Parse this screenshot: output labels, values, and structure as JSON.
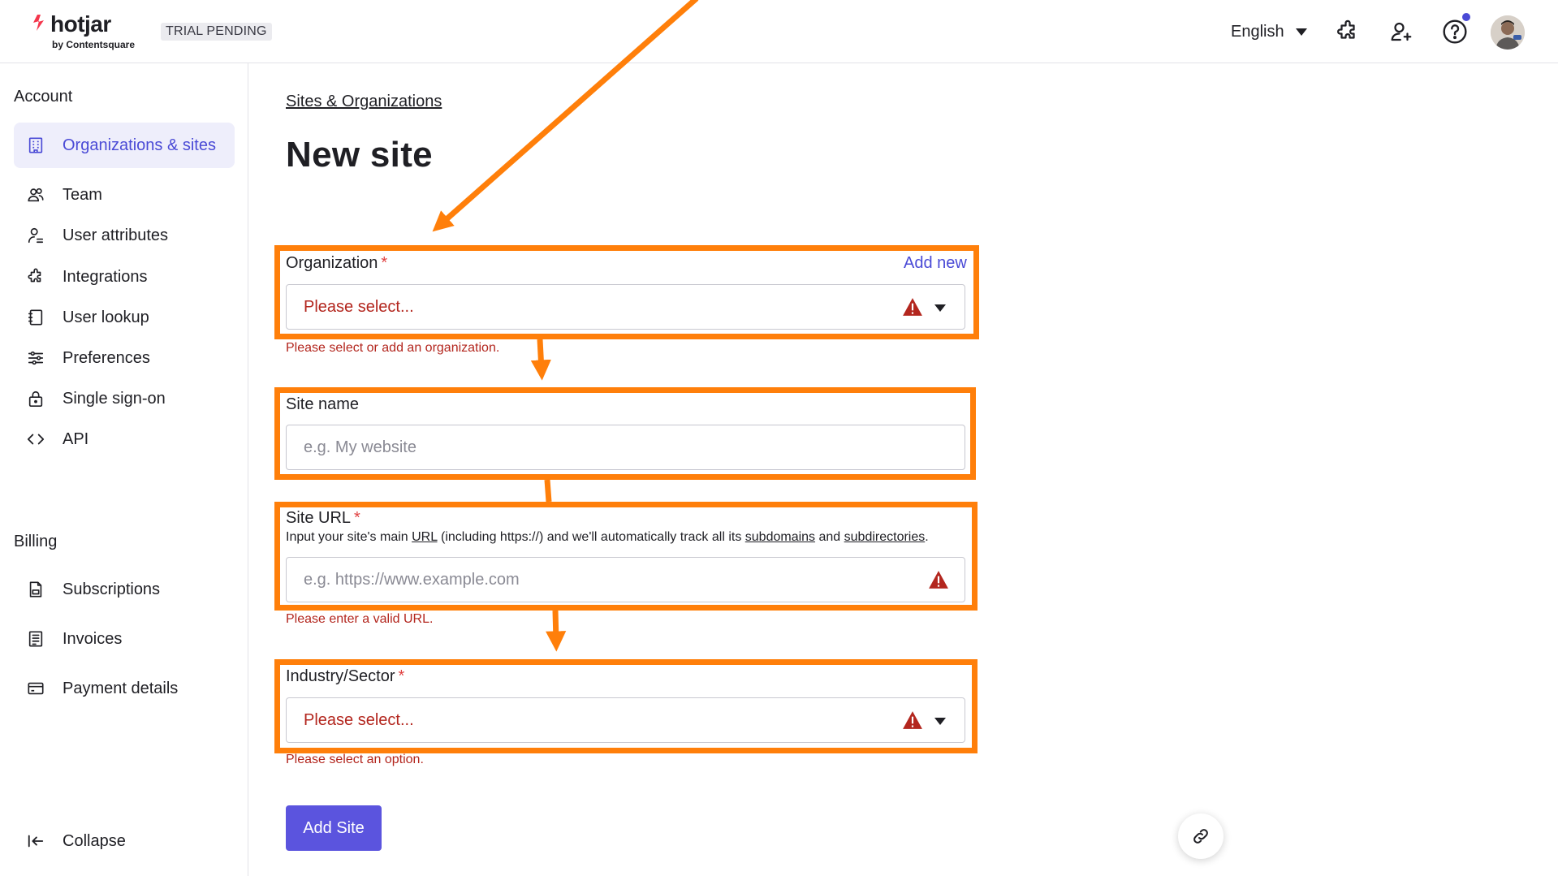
{
  "header": {
    "logo_text": "hotjar",
    "logo_sub": "by Contentsquare",
    "trial_badge": "TRIAL PENDING",
    "language": "English"
  },
  "sidebar": {
    "account_label": "Account",
    "billing_label": "Billing",
    "account_items": [
      {
        "label": "Organizations & sites",
        "icon": "building-icon",
        "active": true
      },
      {
        "label": "Team",
        "icon": "team-icon"
      },
      {
        "label": "User attributes",
        "icon": "user-attributes-icon"
      },
      {
        "label": "Integrations",
        "icon": "puzzle-icon"
      },
      {
        "label": "User lookup",
        "icon": "address-book-icon"
      },
      {
        "label": "Preferences",
        "icon": "sliders-icon"
      },
      {
        "label": "Single sign-on",
        "icon": "lock-icon"
      },
      {
        "label": "API",
        "icon": "code-icon"
      }
    ],
    "billing_items": [
      {
        "label": "Subscriptions",
        "icon": "document-icon"
      },
      {
        "label": "Invoices",
        "icon": "invoice-icon"
      },
      {
        "label": "Payment details",
        "icon": "credit-card-icon"
      }
    ],
    "collapse_label": "Collapse"
  },
  "main": {
    "breadcrumb": "Sites & Organizations",
    "title": "New site",
    "organization": {
      "label": "Organization",
      "required": "*",
      "add_new": "Add new",
      "placeholder": "Please select...",
      "error": "Please select or add an organization."
    },
    "site_name": {
      "label": "Site name",
      "placeholder": "e.g. My website"
    },
    "site_url": {
      "label": "Site URL",
      "required": "*",
      "help_prefix": "Input your site's main ",
      "help_url": "URL",
      "help_mid1": " (including https://) and we'll automatically track all its ",
      "help_subdomains": "subdomains",
      "help_mid2": " and ",
      "help_subdirectories": "subdirectories",
      "help_end": ".",
      "placeholder": "e.g. https://www.example.com",
      "error": "Please enter a valid URL."
    },
    "industry": {
      "label": "Industry/Sector",
      "required": "*",
      "placeholder": "Please select...",
      "error": "Please select an option."
    },
    "submit_label": "Add Site"
  },
  "colors": {
    "accent": "#4a4ad6",
    "button": "#5b54de",
    "error": "#b3261e",
    "annotation": "#ff7f0a"
  }
}
